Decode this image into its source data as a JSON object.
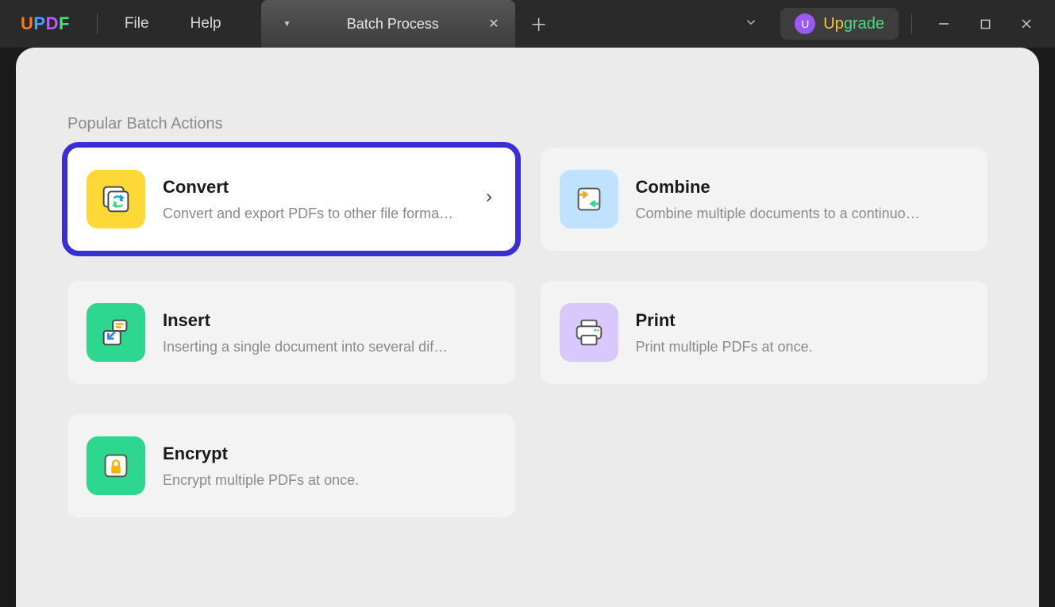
{
  "app": {
    "logo": "UPDF",
    "menu": {
      "file": "File",
      "help": "Help"
    },
    "tab": {
      "title": "Batch Process"
    },
    "upgrade": {
      "avatar": "U",
      "label": "Upgrade"
    }
  },
  "section": {
    "title": "Popular Batch Actions"
  },
  "cards": {
    "convert": {
      "title": "Convert",
      "desc": "Convert and export PDFs to other file forma…"
    },
    "combine": {
      "title": "Combine",
      "desc": "Combine multiple documents to a continuo…"
    },
    "insert": {
      "title": "Insert",
      "desc": "Inserting a single document into several dif…"
    },
    "print": {
      "title": "Print",
      "desc": "Print multiple PDFs at once."
    },
    "encrypt": {
      "title": "Encrypt",
      "desc": "Encrypt multiple PDFs at once."
    }
  }
}
